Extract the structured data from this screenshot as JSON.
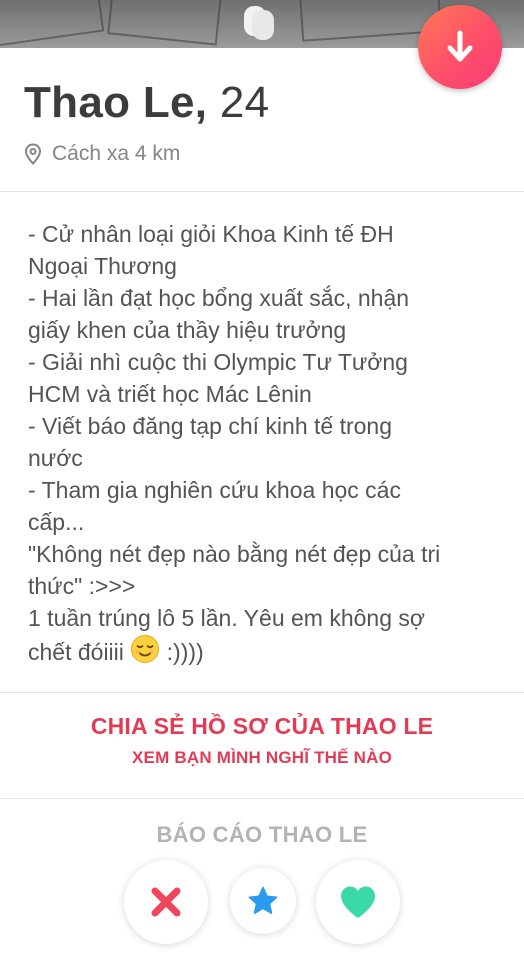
{
  "profile": {
    "name": "Thao Le",
    "separator": ",",
    "age": "24",
    "distance": "Cách xa 4 km"
  },
  "bio": {
    "lines": [
      "- Cử nhân loại giỏi Khoa Kinh tế ĐH",
      "Ngoại Thương",
      "- Hai lần đạt học bổng xuất sắc, nhận",
      "giấy khen của thầy hiệu trưởng",
      "- Giải nhì cuộc thi Olympic Tư Tưởng",
      "HCM và triết học Mác Lênin",
      "- Viết báo đăng tạp chí kinh tế trong",
      "nước",
      "- Tham gia nghiên cứu khoa học các",
      "cấp...",
      "\"Không nét đẹp nào bằng nét đẹp của tri",
      "thức\" :>>>",
      "1 tuần trúng lô 5 lần. Yêu em không sợ",
      "chết đóiiii"
    ],
    "last_line_suffix": ":))))"
  },
  "share": {
    "title": "CHIA SẺ HỒ SƠ CỦA THAO LE",
    "subtitle": "XEM BẠN MÌNH NGHĨ THẾ NÀO"
  },
  "report": {
    "label": "BÁO CÁO THAO LE"
  },
  "actions": {
    "nope_icon": "x-icon",
    "superlike_icon": "star-icon",
    "like_icon": "heart-icon"
  },
  "colors": {
    "brand_gradient_start": "#ff7a54",
    "brand_gradient_end": "#fb3c77",
    "share_text": "#e33b55",
    "nope": "#f0465c",
    "superlike": "#2a9bf0",
    "like": "#3bd9a8"
  }
}
